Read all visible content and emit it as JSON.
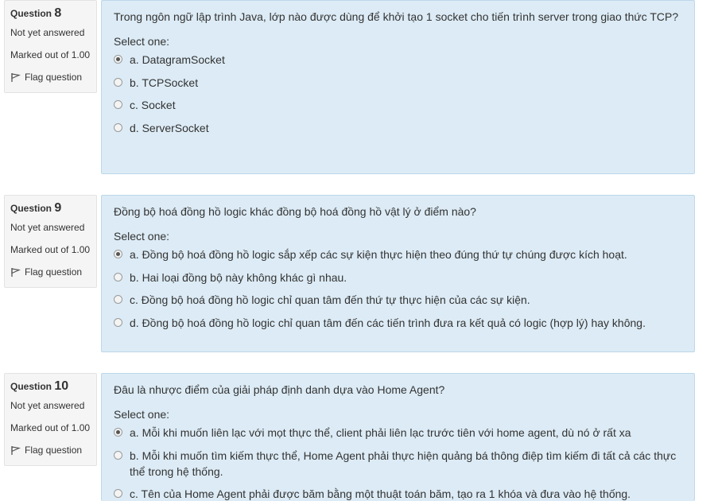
{
  "questions": [
    {
      "label": "Question",
      "number": "8",
      "state": "Not yet answered",
      "grade": "Marked out of 1.00",
      "flag": "Flag question",
      "text": "Trong ngôn ngữ lập trình Java, lớp nào được dùng để khởi tạo 1 socket cho tiến trình server trong giao thức TCP?",
      "prompt": "Select one:",
      "options": [
        {
          "label": "a. DatagramSocket",
          "checked": true
        },
        {
          "label": "b. TCPSocket",
          "checked": false
        },
        {
          "label": "c. Socket",
          "checked": false
        },
        {
          "label": "d. ServerSocket",
          "checked": false
        }
      ]
    },
    {
      "label": "Question",
      "number": "9",
      "state": "Not yet answered",
      "grade": "Marked out of 1.00",
      "flag": "Flag question",
      "text": "Đồng bộ hoá đồng hồ logic khác đồng bộ hoá đồng hồ vật lý ở điểm nào?",
      "prompt": "Select one:",
      "options": [
        {
          "label": "a. Đồng bộ hoá đồng hồ logic sắp xếp các sự kiện thực hiện theo đúng thứ tự chúng được kích hoạt.",
          "checked": true
        },
        {
          "label": "b. Hai loại đồng bộ này không khác gì nhau.",
          "checked": false
        },
        {
          "label": "c. Đồng bộ hoá đồng hồ logic chỉ quan tâm đến thứ tự thực hiện của các sự kiện.",
          "checked": false
        },
        {
          "label": "d. Đồng bộ hoá đồng hồ logic chỉ quan tâm đến các tiến trình đưa ra kết quả có logic (hợp lý) hay không.",
          "checked": false
        }
      ]
    },
    {
      "label": "Question",
      "number": "10",
      "state": "Not yet answered",
      "grade": "Marked out of 1.00",
      "flag": "Flag question",
      "text": "Đâu là nhược điểm của giải pháp định danh dựa vào Home Agent?",
      "prompt": "Select one:",
      "options": [
        {
          "label": "a. Mỗi khi muốn liên lạc với mọt thực thể, client phải liên lạc trước tiên với home agent, dù nó ở rất xa",
          "checked": true
        },
        {
          "label": "b. Mỗi khi muốn tìm kiếm thực thể, Home Agent phải thực hiện quảng bá thông điệp tìm kiếm đi tất cả các thực thể trong hệ thống.",
          "checked": false
        },
        {
          "label": "c. Tên của Home Agent phải được băm bằng một thuật toán băm, tạo ra 1 khóa và đưa vào hệ thống.",
          "checked": false
        }
      ]
    }
  ]
}
